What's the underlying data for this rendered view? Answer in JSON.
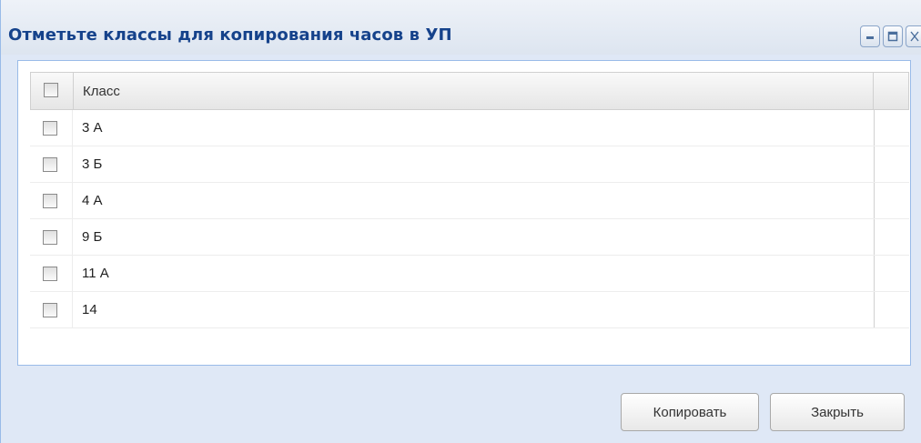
{
  "window": {
    "title": "Отметьте классы для копирования часов в УП",
    "tool_buttons": [
      {
        "icon": "minimize-icon"
      },
      {
        "icon": "maximize-icon"
      },
      {
        "icon": "close-icon",
        "label": "X"
      }
    ]
  },
  "grid": {
    "columns": [
      {
        "type": "checkbox"
      },
      {
        "label": "Класс"
      }
    ],
    "rows": [
      {
        "label": "3 А",
        "checked": false
      },
      {
        "label": "3 Б",
        "checked": false
      },
      {
        "label": "4 А",
        "checked": false
      },
      {
        "label": "9 Б",
        "checked": false
      },
      {
        "label": "11 А",
        "checked": false
      },
      {
        "label": "14",
        "checked": false
      }
    ]
  },
  "footer": {
    "copy_label": "Копировать",
    "close_label": "Закрыть"
  },
  "colors": {
    "title": "#15428b",
    "window_bg": "#dfe8f6",
    "grid_border": "#99bbe8"
  }
}
